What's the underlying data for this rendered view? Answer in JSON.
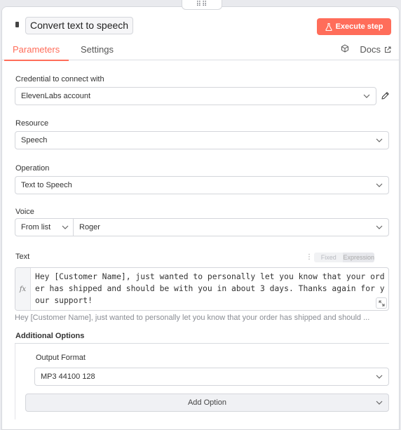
{
  "header": {
    "node_title": "Convert text to speech",
    "execute_label": "Execute step",
    "tabs": [
      {
        "label": "Parameters",
        "active": true
      },
      {
        "label": "Settings",
        "active": false
      }
    ],
    "docs_label": "Docs",
    "accent_color": "#ff6d5a"
  },
  "credential": {
    "label": "Credential to connect with",
    "value": "ElevenLabs account"
  },
  "resource": {
    "label": "Resource",
    "value": "Speech"
  },
  "operation": {
    "label": "Operation",
    "value": "Text to Speech"
  },
  "voice": {
    "label": "Voice",
    "mode": "From list",
    "value": "Roger"
  },
  "text_param": {
    "label": "Text",
    "toggle_fixed": "Fixed",
    "toggle_expression": "Expression",
    "fx": "fx",
    "value": "Hey [Customer Name], just wanted to personally let you know that your order has shipped and should be with you in about 3 days. Thanks again for your support!",
    "preview": "Hey [Customer Name], just wanted to personally let you know that your order has shipped and should ..."
  },
  "additional_options": {
    "label": "Additional Options",
    "output_format_label": "Output Format",
    "output_format_value": "MP3 44100 128",
    "add_option_label": "Add Option"
  },
  "icons": {
    "drag": "drag-handle-icon",
    "flask": "flask-icon",
    "cube": "cube-icon",
    "external": "external-link-icon",
    "pencil": "pencil-icon",
    "chevron": "chevron-down-icon",
    "expand": "expand-icon"
  }
}
